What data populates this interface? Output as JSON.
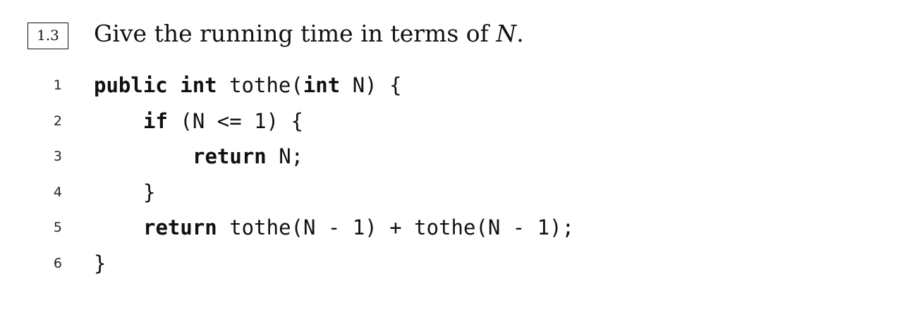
{
  "problem": {
    "number": "1.3",
    "question_prefix": "Give the running time in terms of ",
    "question_variable": "N",
    "question_suffix": "."
  },
  "code": {
    "lines": [
      {
        "number": "1",
        "indent": 0,
        "tokens": [
          {
            "text": "public",
            "keyword": true
          },
          {
            "text": " ",
            "keyword": false
          },
          {
            "text": "int",
            "keyword": true
          },
          {
            "text": " tothe(",
            "keyword": false
          },
          {
            "text": "int",
            "keyword": true
          },
          {
            "text": " N) {",
            "keyword": false
          }
        ]
      },
      {
        "number": "2",
        "indent": 1,
        "tokens": [
          {
            "text": "if",
            "keyword": true
          },
          {
            "text": " (N <= 1) {",
            "keyword": false
          }
        ]
      },
      {
        "number": "3",
        "indent": 2,
        "tokens": [
          {
            "text": "return",
            "keyword": true
          },
          {
            "text": " N;",
            "keyword": false
          }
        ]
      },
      {
        "number": "4",
        "indent": 1,
        "tokens": [
          {
            "text": "}",
            "keyword": false
          }
        ]
      },
      {
        "number": "5",
        "indent": 1,
        "tokens": [
          {
            "text": "return",
            "keyword": true
          },
          {
            "text": " tothe(N - 1) + tothe(N - 1);",
            "keyword": false
          }
        ]
      },
      {
        "number": "6",
        "indent": 0,
        "tokens": [
          {
            "text": "}",
            "keyword": false
          }
        ]
      }
    ]
  }
}
